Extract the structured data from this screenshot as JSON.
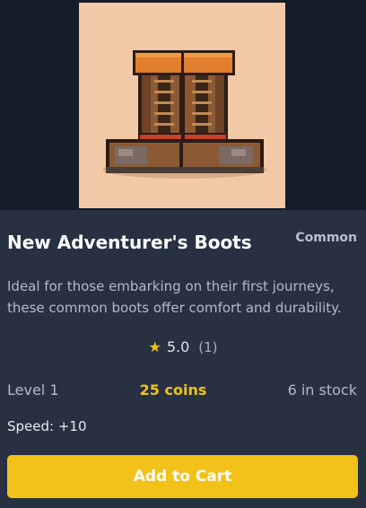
{
  "item": {
    "name": "New Adventurer's Boots",
    "rarity": "Common",
    "image_icon": "boots-icon",
    "description": "Ideal for those embarking on their first journeys, these common boots offer comfort and durability.",
    "rating": {
      "star_icon": "★",
      "value": "5.0",
      "count": "(1)"
    },
    "level": "Level 1",
    "price": "25 coins",
    "stock": "6 in stock",
    "stats": "Speed: +10"
  },
  "actions": {
    "add_to_cart": "Add to Cart"
  },
  "colors": {
    "background": "#161d2a",
    "panel": "#273141",
    "accent": "#f2c21a",
    "image_bg": "#f1c9a6"
  }
}
